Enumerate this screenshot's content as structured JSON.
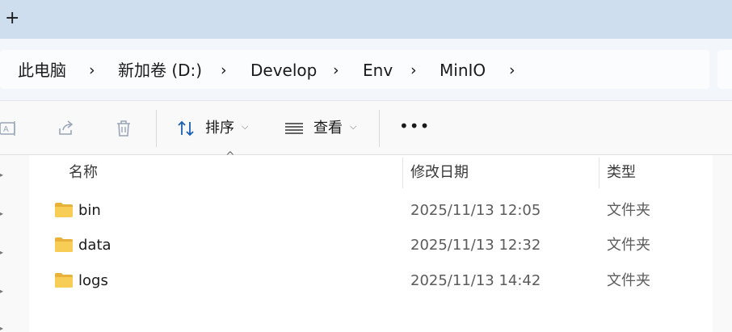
{
  "tabstrip": {
    "new_tab_glyph": "+"
  },
  "breadcrumb": {
    "items": [
      "此电脑",
      "新加卷 (D:)",
      "Develop",
      "Env",
      "MinIO"
    ],
    "separator": "›"
  },
  "toolbar": {
    "icons": [
      "rename-icon",
      "share-icon",
      "delete-icon"
    ],
    "sort_label": "排序",
    "view_label": "查看",
    "more_label": "•••"
  },
  "columns": {
    "name": "名称",
    "date": "修改日期",
    "type": "类型"
  },
  "files": [
    {
      "name": "bin",
      "date": "2025/11/13 12:05",
      "type": "文件夹"
    },
    {
      "name": "data",
      "date": "2025/11/13 12:32",
      "type": "文件夹"
    },
    {
      "name": "logs",
      "date": "2025/11/13 14:42",
      "type": "文件夹"
    }
  ],
  "colors": {
    "tabstrip": "#cfdeef",
    "accent": "#1a5fb4",
    "folder": "#f5c742"
  }
}
